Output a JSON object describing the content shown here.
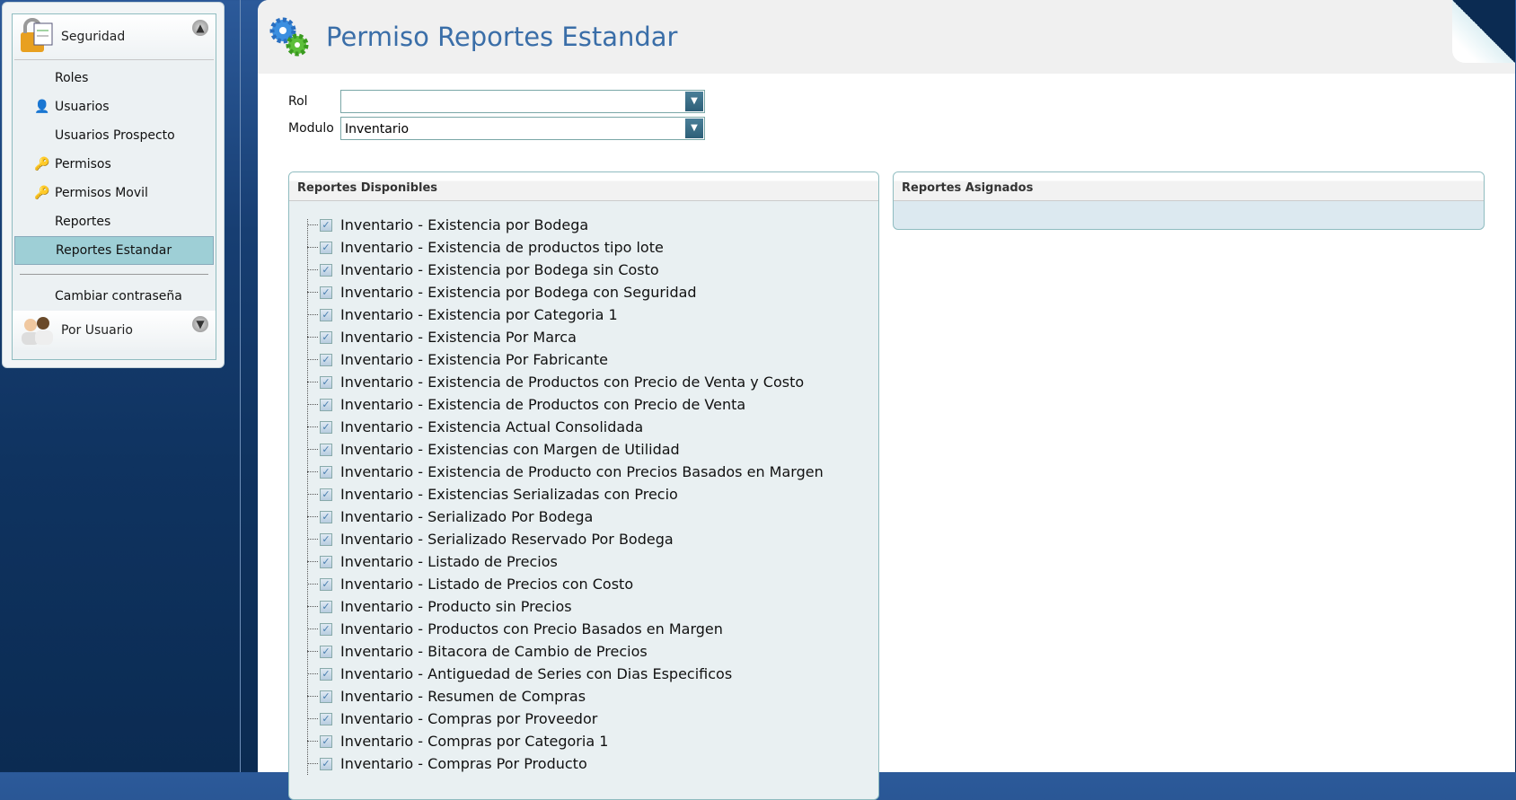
{
  "sidebar": {
    "section1": "Seguridad",
    "items": [
      {
        "label": "Roles",
        "icon": ""
      },
      {
        "label": "Usuarios",
        "icon": "user-icon"
      },
      {
        "label": "Usuarios Prospecto",
        "icon": ""
      },
      {
        "label": "Permisos",
        "icon": "key-icon"
      },
      {
        "label": "Permisos Movil",
        "icon": "key-icon"
      },
      {
        "label": "Reportes",
        "icon": ""
      },
      {
        "label": "Reportes Estandar",
        "icon": "",
        "selected": true
      }
    ],
    "change_password": "Cambiar contraseña",
    "section2": "Por Usuario"
  },
  "page": {
    "title": "Permiso Reportes Estandar"
  },
  "form": {
    "rol_label": "Rol",
    "rol_value": "",
    "modulo_label": "Modulo",
    "modulo_value": "Inventario"
  },
  "available": {
    "title": "Reportes Disponibles",
    "items": [
      "Inventario - Existencia por Bodega",
      "Inventario - Existencia de productos tipo lote",
      "Inventario - Existencia por Bodega sin Costo",
      "Inventario - Existencia por Bodega con Seguridad",
      "Inventario - Existencia por Categoria 1",
      "Inventario - Existencia Por Marca",
      "Inventario - Existencia Por Fabricante",
      "Inventario - Existencia de Productos con Precio de Venta y Costo",
      "Inventario - Existencia de Productos con Precio de Venta",
      "Inventario - Existencia Actual Consolidada",
      "Inventario - Existencias con Margen de Utilidad",
      "Inventario - Existencia de Producto con Precios Basados en Margen",
      "Inventario - Existencias Serializadas con Precio",
      "Inventario - Serializado Por Bodega",
      "Inventario - Serializado Reservado Por Bodega",
      "Inventario - Listado de Precios",
      "Inventario - Listado de Precios con Costo",
      "Inventario - Producto sin Precios",
      "Inventario - Productos con Precio Basados en Margen",
      "Inventario - Bitacora de Cambio de Precios",
      "Inventario - Antiguedad de Series con Dias Especificos",
      "Inventario - Resumen de Compras",
      "Inventario - Compras por Proveedor",
      "Inventario - Compras por Categoria 1",
      "Inventario - Compras Por Producto"
    ]
  },
  "assigned": {
    "title": "Reportes Asignados"
  }
}
